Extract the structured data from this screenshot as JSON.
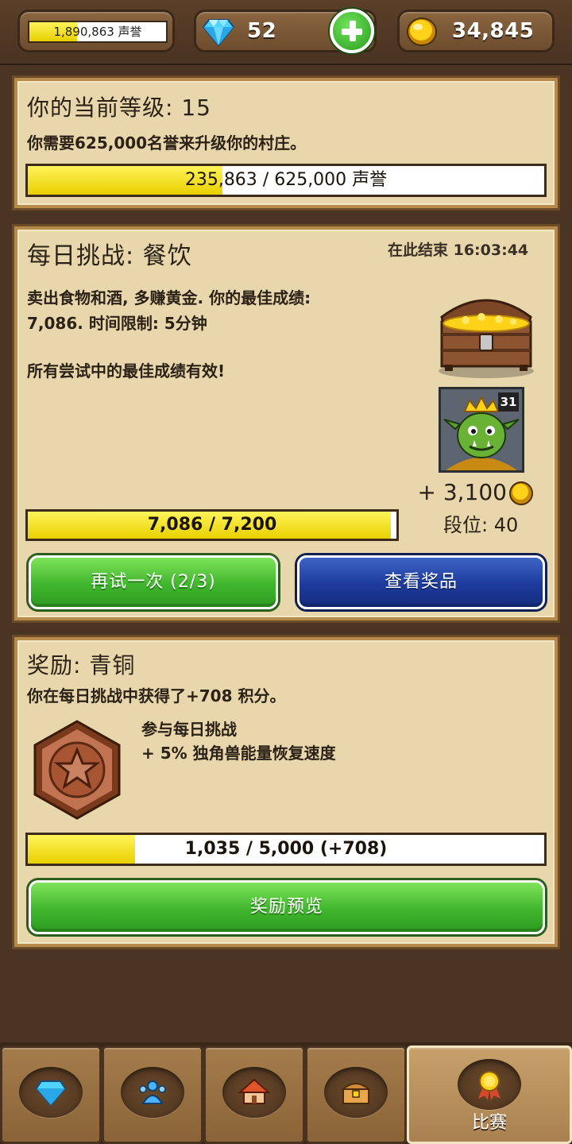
{
  "topbar": {
    "reputation": {
      "text": "1,890,863 声誉",
      "progress": 0.35
    },
    "gems": "52",
    "gold": "34,845"
  },
  "level_panel": {
    "title": "你的当前等级: 15",
    "description": "你需要625,000名誉来升级你的村庄。",
    "progress_text": "235,863 / 625,000 声誉",
    "progress": 0.377
  },
  "challenge_panel": {
    "title": "每日挑战: 餐饮",
    "ends_at": "在此结束 16:03:44",
    "desc_line1": "卖出食物和酒, 多赚黄金. 你的最佳成绩:",
    "desc_line2": "7,086. 时间限制: 5分钟",
    "note": "所有尝试中的最佳成绩有效!",
    "rival_level": "31",
    "reward_gold": "+ 3,100",
    "rank": "段位: 40",
    "progress_text": "7,086 / 7,200",
    "progress": 0.984,
    "retry_button": "再试一次 (2/3)",
    "view_prizes_button": "查看奖品"
  },
  "reward_panel": {
    "title": "奖励: 青铜",
    "earned": "你在每日挑战中获得了+708 积分。",
    "perk_line1": "参与每日挑战",
    "perk_line2": "+ 5% 独角兽能量恢复速度",
    "progress_text": "1,035 / 5,000 (+708)",
    "progress": 0.207,
    "preview_button": "奖励预览"
  },
  "nav": {
    "tabs": [
      {
        "icon": "diamond-icon"
      },
      {
        "icon": "people-icon"
      },
      {
        "icon": "village-icon"
      },
      {
        "icon": "chest-icon"
      },
      {
        "icon": "medal-icon",
        "label": "比赛",
        "active": true
      }
    ]
  },
  "colors": {
    "bar_fill": "#e9d000",
    "panel_bg": "#e8d7ac",
    "green_button": "#3fb52d",
    "blue_button": "#1d3b9d"
  }
}
